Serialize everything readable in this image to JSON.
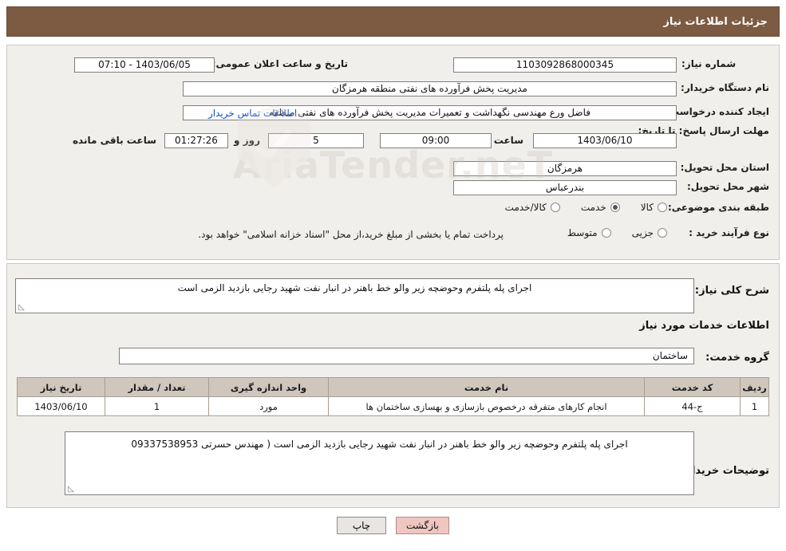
{
  "header": {
    "title": "جزئیات اطلاعات نیاز"
  },
  "form": {
    "need_number_label": "شماره نیاز:",
    "need_number_value": "1103092868000345",
    "announce_date_label": "تاریخ و ساعت اعلان عمومی:",
    "announce_date_value": "1403/06/05 - 07:10",
    "buyer_org_label": "نام دستگاه خریدار:",
    "buyer_org_value": "مدیریت پخش فرآورده های نفتی منطقه هرمزگان",
    "requester_label": "ایجاد کننده درخواست:",
    "requester_value": "فاضل ورع مهندسی نگهداشت و تعمیرات مدیریت پخش فرآورده های نفتی منطقه",
    "buyer_contact_link": "اطلاعات تماس خریدار",
    "deadline_label": "مهلت ارسال پاسخ: تا تاریخ:",
    "deadline_date": "1403/06/10",
    "hour_label": "ساعت",
    "deadline_time": "09:00",
    "days_value": "5",
    "days_label": "روز و",
    "remaining_time": "01:27:26",
    "remaining_label": "ساعت باقی مانده",
    "province_label": "استان محل تحویل:",
    "province_value": "هرمزگان",
    "city_label": "شهر محل تحویل:",
    "city_value": "بندرعباس",
    "category_label": "طبقه بندی موضوعی:",
    "category_options": [
      "کالا",
      "خدمت",
      "کالا/خدمت"
    ],
    "category_selected": "خدمت",
    "purchase_type_label": "نوع فرآیند خرید :",
    "purchase_type_options": [
      "جزیی",
      "متوسط"
    ],
    "purchase_type_selected": "",
    "purchase_note": "پرداخت تمام یا بخشی از مبلغ خرید،از محل \"اسناد خزانه اسلامی\" خواهد بود."
  },
  "watermark": {
    "text": "AriaTender.neT"
  },
  "details": {
    "general_desc_label": "شرح کلی نیاز:",
    "general_desc_value": "اجرای پله پلتفرم وحوضچه زیر والو خط باهنر در انبار نفت شهید رجایی  بازدید الزمی است",
    "services_info_title": "اطلاعات خدمات مورد نیاز",
    "service_group_label": "گروه خدمت:",
    "service_group_value": "ساختمان",
    "table": {
      "headers": [
        "ردیف",
        "کد خدمت",
        "نام خدمت",
        "واحد اندازه گیری",
        "تعداد / مقدار",
        "تاریخ نیاز"
      ],
      "rows": [
        {
          "row": "1",
          "code": "ج-44",
          "name": "انجام کارهای متفرقه درخصوص بازسازی و بهسازی ساختمان ها",
          "unit": "مورد",
          "qty": "1",
          "date": "1403/06/10"
        }
      ]
    },
    "buyer_notes_label": "توضیحات خریدار:",
    "buyer_notes_value": "اجرای پله پلتفرم وحوضچه زیر والو خط باهنر در انبار نفت شهید رجایی  بازدید الزمی است ( مهندس حسرتی 09337538953"
  },
  "footer": {
    "print_label": "چاپ",
    "back_label": "بازگشت"
  },
  "colors": {
    "header_bg": "#7c5b42",
    "panel_bg": "#f1efeb",
    "link": "#0b4fd0",
    "back_btn": "#f0c6c0"
  }
}
